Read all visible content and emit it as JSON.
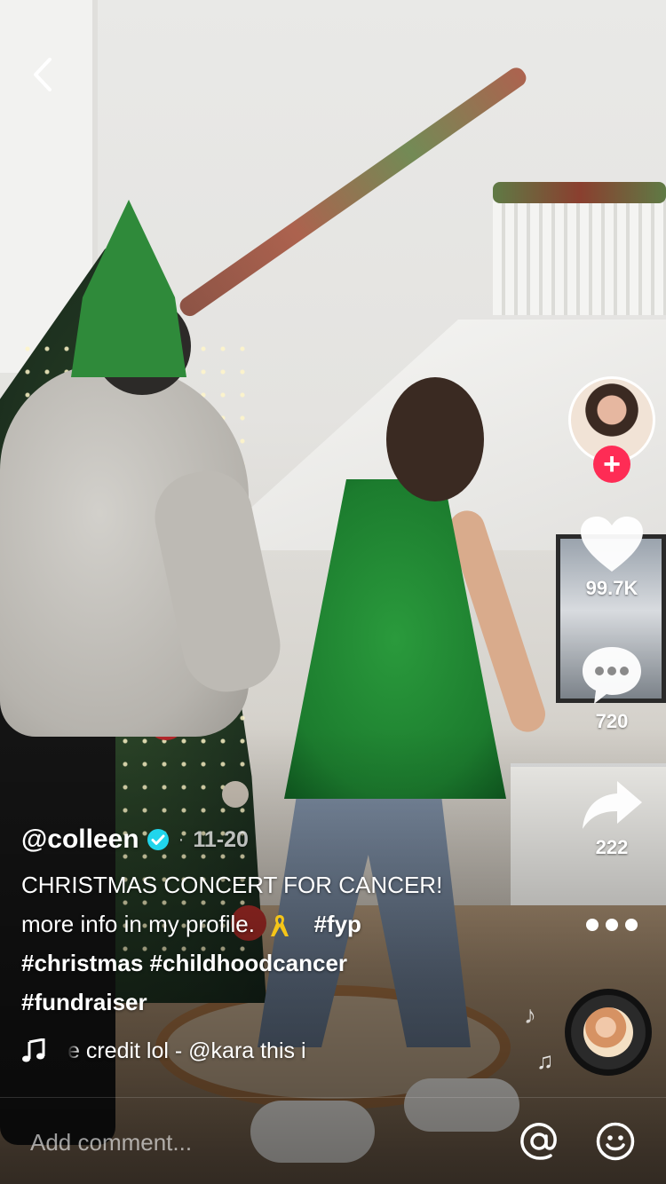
{
  "nav": {
    "back_icon": "chevron-left-icon"
  },
  "creator": {
    "avatar_icon": "profile-avatar",
    "follow_icon": "plus-icon",
    "follow_label": "+",
    "follow_color": "#fe2c55"
  },
  "actions": {
    "likes": "99.7K",
    "comments": "720",
    "shares": "222",
    "like_icon": "heart-icon",
    "comment_icon": "chat-bubble-icon",
    "share_icon": "share-arrow-icon",
    "more_icon": "more-dots-icon"
  },
  "post": {
    "username": "@colleen",
    "verified_icon": "verified-badge-icon",
    "verified_color": "#20d5ec",
    "date_separator": "·",
    "date": "11-20",
    "caption_line1": "CHRISTMAS CONCERT FOR CANCER!",
    "caption_line2_text": "more info in my profile.",
    "ribbon_icon": "yellow-ribbon-icon",
    "hashtags_line2": "#fyp",
    "hashtags_line3": "#christmas #childhoodcancer",
    "hashtags_line4": "#fundraiser"
  },
  "sound": {
    "note_icon": "music-note-icon",
    "text": "e credit lol - @kara      this i"
  },
  "comment_bar": {
    "placeholder": "Add comment...",
    "mention_icon": "at-sign-icon",
    "emoji_icon": "smiley-icon"
  }
}
